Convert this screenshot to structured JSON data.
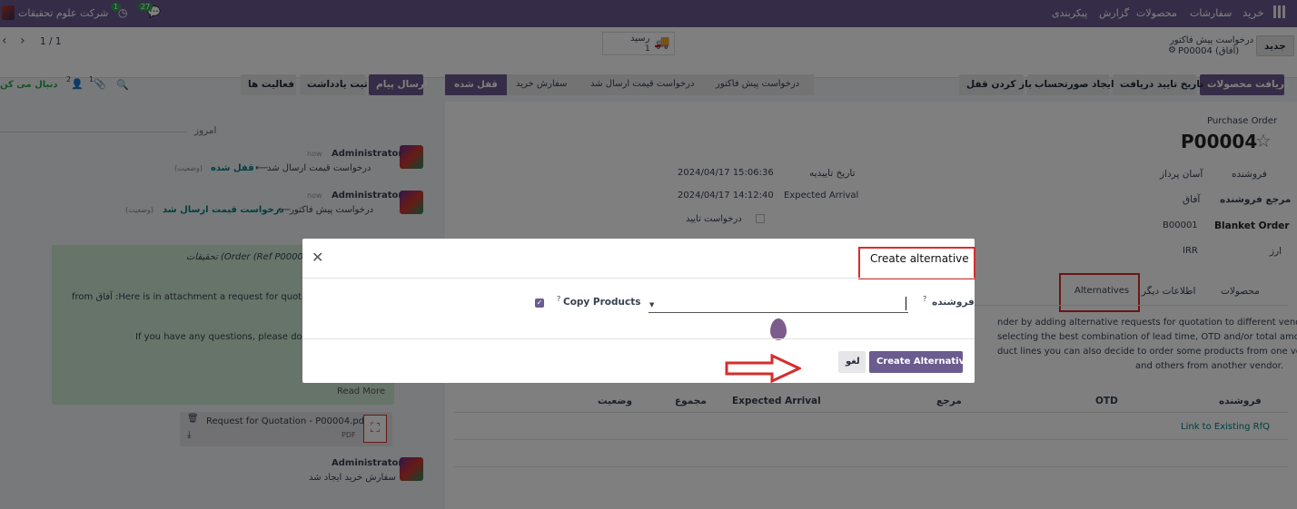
{
  "topbar": {
    "company": "شرکت علوم تحقیقات",
    "badge1": "1",
    "badge2": "27",
    "menu": [
      "خرید",
      "سفارشات",
      "محصولات",
      "گزارش",
      "پیکربندی"
    ]
  },
  "control": {
    "new": "جدید",
    "breadcrumb_parent": "درخواست پیش فاکتور",
    "breadcrumb_current": "P00004 (آفاق)",
    "receipt_label": "رسید",
    "receipt_count": "1",
    "pager": "1 / 1"
  },
  "toolbar": {
    "receive": "دریافت محصولات",
    "confirm_receipt_date": "تاریخ تایید دریافت",
    "create_bill": "ایجاد صورتحساب",
    "unlock": "باز کردن قفل"
  },
  "status": [
    "درخواست پیش فاکتور",
    "درخواست قیمت ارسال شد",
    "سفارش خرید",
    "قفل شده"
  ],
  "chatter_tools": {
    "send": "ارسال پیام",
    "log": "ثبت یادداشت",
    "activities": "فعالیت ها",
    "follow": "دنبال می کن",
    "att_count": "1",
    "followers": "2"
  },
  "form": {
    "kind": "Purchase Order",
    "name": "P00004",
    "vendor_label": "فروشنده",
    "vendor": "آسان پرداز",
    "vendor_ref_label": "مرجع فروشنده",
    "vendor_ref": "آفاق",
    "blanket_label": "Blanket Order",
    "blanket": "B00001",
    "currency_label": "ارز",
    "currency": "IRR",
    "confirm_date_label": "تاریخ تاییدیه",
    "confirm_date": "2024/04/17 15:06:36",
    "arrival_label": "Expected Arrival",
    "arrival": "2024/04/17 14:12:40",
    "ack_label": "درخواست تایید"
  },
  "tabs": [
    "محصولات",
    "اطلاعات دیگر",
    "Alternatives"
  ],
  "alt_text": [
    "nder by adding alternative requests for quotation to different vendors.",
    "selecting the best combination of lead time, OTD and/or total amount.",
    "duct lines you can also decide to order some products from one vendor",
    "and others from another vendor."
  ],
  "alt_table": {
    "headers": [
      "فروشنده",
      "OTD",
      "مرجع",
      "Expected Arrival",
      "مجموع",
      "وضعیت"
    ],
    "link": "Link to Existing RfQ"
  },
  "chatter": {
    "today": "امروز",
    "author": "Administrator",
    "when": "now",
    "m1_from": "درخواست قیمت ارسال شد",
    "m1_to": "قفل شده",
    "m1_field": "(وضعیت)",
    "m2_from": "درخواست پیش فاکتور",
    "m2_to": "درخواست قیمت ارسال شد",
    "m2_field": "(وضعیت)",
    "mail_subject": "تحقیقات (Order (Ref P00004",
    "mail_line1": "from آفاق :Here is in attachment a request for quotation P0",
    "mail_line2": "If you have any questions, please do not h.",
    "read_more": "Read More",
    "att_name": "Request for Quotation - P00004.pdf",
    "att_type": "PDF",
    "last": "سفارش خرید ایجاد شد"
  },
  "modal": {
    "title": "Create alternative",
    "vendor_label": "فروشنده",
    "vendor_value": "",
    "copy_label": "Copy Products",
    "create": "Create Alternative",
    "cancel": "لغو"
  },
  "colors": {
    "brand": "#6b5b8f",
    "annotation": "#d62d2d",
    "link": "#017e84"
  }
}
